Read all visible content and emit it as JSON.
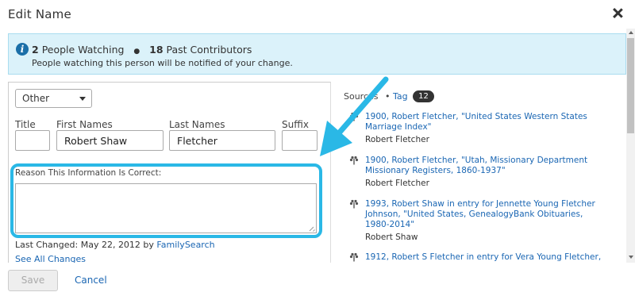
{
  "dialog": {
    "title": "Edit Name"
  },
  "watchers": {
    "people_count": "2",
    "people_label": "People Watching",
    "separator": "●",
    "contributors_count": "18",
    "contributors_label": "Past Contributors",
    "notice": "People watching this person will be notified of your change."
  },
  "form": {
    "name_type": "Other",
    "labels": {
      "title": "Title",
      "first_names": "First Names",
      "last_names": "Last Names",
      "suffix": "Suffix"
    },
    "values": {
      "title": "",
      "first_names": "Robert Shaw",
      "last_names": "Fletcher",
      "suffix": ""
    },
    "reason_label": "Reason This Information Is Correct:",
    "reason_value": "",
    "last_changed_prefix": "Last Changed: May 22, 2012 by",
    "last_changed_by": "FamilySearch",
    "see_all_changes": "See All Changes"
  },
  "sources": {
    "label": "Sources",
    "dot": "•",
    "tag_label": "Tag",
    "count": "12",
    "items": [
      {
        "title": "1900, Robert Fletcher, \"United States Western States Marriage Index\"",
        "name": "Robert Fletcher"
      },
      {
        "title": "1900, Robert Fletcher, \"Utah, Missionary Department Missionary Registers, 1860-1937\"",
        "name": "Robert Fletcher"
      },
      {
        "title": "1993, Robert Shaw in entry for Jennette Young Fletcher Johnson, \"United States, GenealogyBank Obituaries, 1980-2014\"",
        "name": "Robert Shaw"
      },
      {
        "title": "1912, Robert S Fletcher in entry for Vera Young Fletcher,",
        "name": ""
      }
    ]
  },
  "footer": {
    "save_label": "Save",
    "cancel_label": "Cancel"
  },
  "colors": {
    "info_bg": "#dbf2fa",
    "highlight": "#2ab8e6",
    "link": "#1a66b3"
  }
}
